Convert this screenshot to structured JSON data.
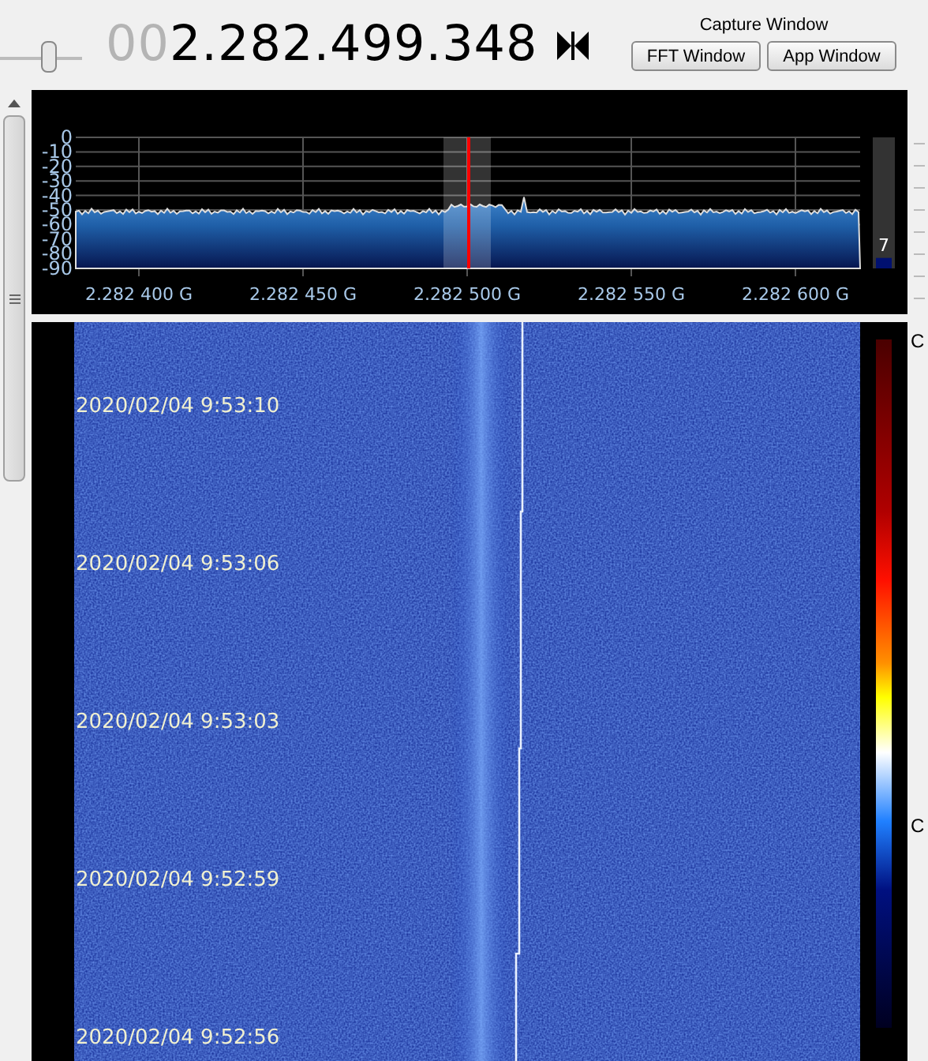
{
  "toolbar": {
    "zoom_slider": {
      "level": 0.6
    },
    "frequency_prefix": "00",
    "frequency": "2.282.499.348",
    "capture_label": "Capture Window",
    "buttons": [
      "FFT Window",
      "App Window"
    ]
  },
  "spectrum": {
    "y_labels": [
      "0",
      "-10",
      "-20",
      "-30",
      "-40",
      "-50",
      "-60",
      "-70",
      "-80",
      "-90"
    ],
    "x_labels": [
      "2.282 400 G",
      "2.282 450 G",
      "2.282 500 G",
      "2.282 550 G",
      "2.282 600 G"
    ],
    "meter": {
      "level": 0.08,
      "reading": "7"
    }
  },
  "waterfall": {
    "timestamps": [
      "2020/02/04 9:53:10",
      "2020/02/04 9:53:06",
      "2020/02/04 9:53:03",
      "2020/02/04 9:52:59",
      "2020/02/04 9:52:56"
    ],
    "scale_labels": [
      "C",
      "C"
    ]
  }
}
